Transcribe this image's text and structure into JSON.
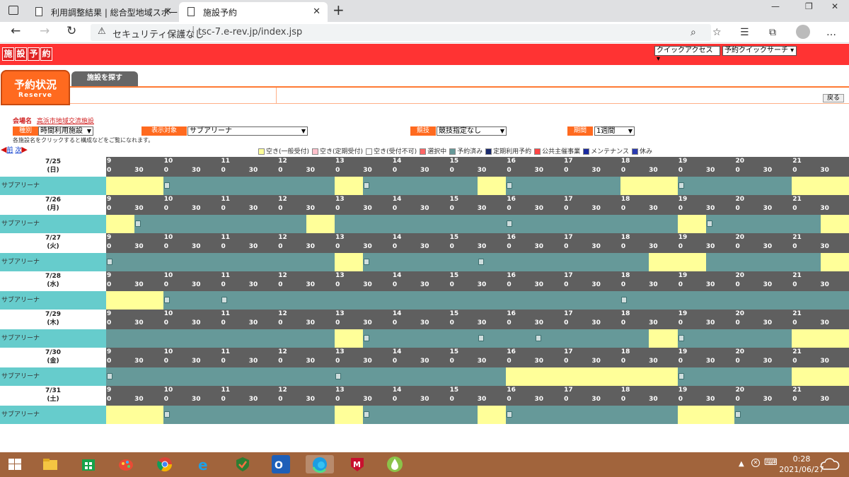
{
  "browser": {
    "tabs": [
      {
        "title": "利用調整結果 | 総合型地域スポー"
      },
      {
        "title": "施設予約"
      }
    ],
    "security_label": "セキュリティ保護なし",
    "url": "tsc-7.e-rev.jp/index.jsp"
  },
  "header": {
    "logo_chars": [
      "施",
      "設",
      "予",
      "約"
    ],
    "quick_access": "クイックアクセス",
    "quick_search": "予約クイックサーチ"
  },
  "tabs": {
    "reserve_title": "予約状況",
    "reserve_sub": "Reserve",
    "search_tab": "施設を探す",
    "back_button": "戻る"
  },
  "filters": {
    "venue_label": "会場名",
    "venue_name": "高浜市地域交流施設",
    "type_label": "種別",
    "type_value": "時間利用施設",
    "target_label": "表示対象",
    "target_value": "サブアリーナ",
    "sport_label": "競技",
    "sport_value": "競技指定なし",
    "period_label": "期間",
    "period_value": "1週間",
    "hint": "各施設名をクリックすると構成などをご覧になれます。",
    "prev": "前",
    "next": "次"
  },
  "legend": [
    {
      "label": "空き(一般受付)",
      "color": "#ffff99"
    },
    {
      "label": "空き(定期受付)",
      "color": "#ffc0cb"
    },
    {
      "label": "空き(受付不可)",
      "color": "#ffffff"
    },
    {
      "label": "選択中",
      "color": "#ff6666"
    },
    {
      "label": "予約済み",
      "color": "#669999"
    },
    {
      "label": "定期利用予約",
      "color": "#1a2a6e"
    },
    {
      "label": "公共主催事業",
      "color": "#ff4444"
    },
    {
      "label": "メンテナンス",
      "color": "#1a2aa0"
    },
    {
      "label": "休み",
      "color": "#2a3ab0"
    }
  ],
  "schedule": {
    "facility": "サブアリーナ",
    "hours": [
      "9",
      "10",
      "11",
      "12",
      "13",
      "14",
      "15",
      "16",
      "17",
      "18",
      "19",
      "20",
      "21"
    ],
    "minutes": [
      "0",
      "30"
    ],
    "days": [
      {
        "date": "7/25",
        "dow": "(日)",
        "free": [
          [
            0,
            2
          ],
          [
            8,
            9
          ],
          [
            13,
            14
          ],
          [
            18,
            20
          ],
          [
            24,
            26
          ]
        ],
        "marks": [
          2,
          9,
          14,
          20
        ]
      },
      {
        "date": "7/26",
        "dow": "(月)",
        "free": [
          [
            0,
            1
          ],
          [
            7,
            8
          ],
          [
            20,
            21
          ],
          [
            25,
            26
          ]
        ],
        "marks": [
          1,
          14,
          21
        ]
      },
      {
        "date": "7/27",
        "dow": "(火)",
        "free": [
          [
            8,
            9
          ],
          [
            19,
            21
          ],
          [
            25,
            26
          ]
        ],
        "marks": [
          0,
          9,
          13
        ]
      },
      {
        "date": "7/28",
        "dow": "(水)",
        "free": [
          [
            0,
            2
          ]
        ],
        "marks": [
          2,
          4,
          18
        ]
      },
      {
        "date": "7/29",
        "dow": "(木)",
        "free": [
          [
            8,
            9
          ],
          [
            19,
            20
          ],
          [
            24,
            26
          ]
        ],
        "marks": [
          9,
          13,
          15,
          20
        ]
      },
      {
        "date": "7/30",
        "dow": "(金)",
        "free": [
          [
            14,
            20
          ],
          [
            24,
            26
          ]
        ],
        "marks": [
          0,
          8,
          20
        ]
      },
      {
        "date": "7/31",
        "dow": "(土)",
        "free": [
          [
            0,
            2
          ],
          [
            8,
            9
          ],
          [
            13,
            14
          ],
          [
            20,
            22
          ]
        ],
        "marks": [
          2,
          9,
          14,
          22
        ]
      }
    ]
  },
  "taskbar": {
    "time": "0:28",
    "date": "2021/06/27"
  }
}
